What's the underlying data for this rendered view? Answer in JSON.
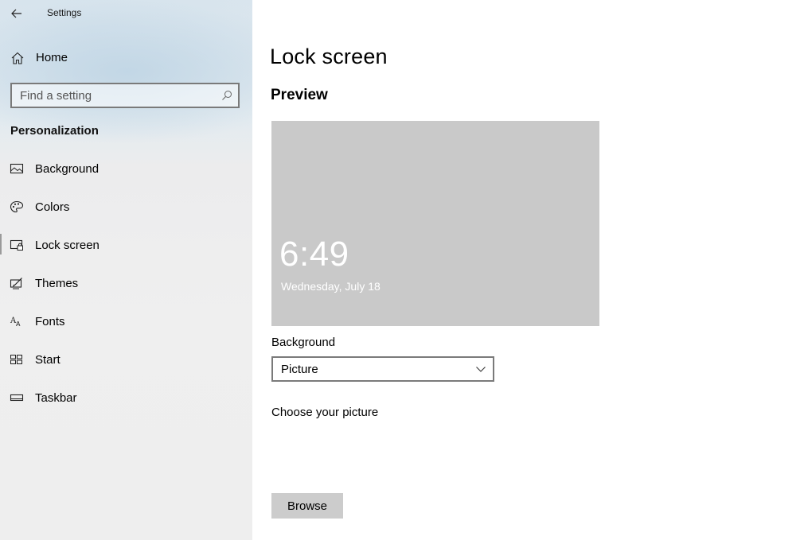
{
  "window": {
    "title": "Settings"
  },
  "sidebar": {
    "home_label": "Home",
    "search_placeholder": "Find a setting",
    "section": "Personalization",
    "items": [
      {
        "label": "Background",
        "icon": "picture-icon"
      },
      {
        "label": "Colors",
        "icon": "palette-icon"
      },
      {
        "label": "Lock screen",
        "icon": "lock-screen-icon",
        "selected": true
      },
      {
        "label": "Themes",
        "icon": "themes-brush-icon"
      },
      {
        "label": "Fonts",
        "icon": "fonts-icon"
      },
      {
        "label": "Start",
        "icon": "start-tiles-icon"
      },
      {
        "label": "Taskbar",
        "icon": "taskbar-icon"
      }
    ]
  },
  "main": {
    "title": "Lock screen",
    "preview_heading": "Preview",
    "preview": {
      "time": "6:49",
      "date": "Wednesday, July 18"
    },
    "background_label": "Background",
    "background_value": "Picture",
    "choose_picture_label": "Choose your picture",
    "browse_label": "Browse"
  },
  "colors": {
    "preview_bg": "#c9c9c9",
    "browse_bg": "#cccccc",
    "input_border": "#7a7a7a"
  }
}
